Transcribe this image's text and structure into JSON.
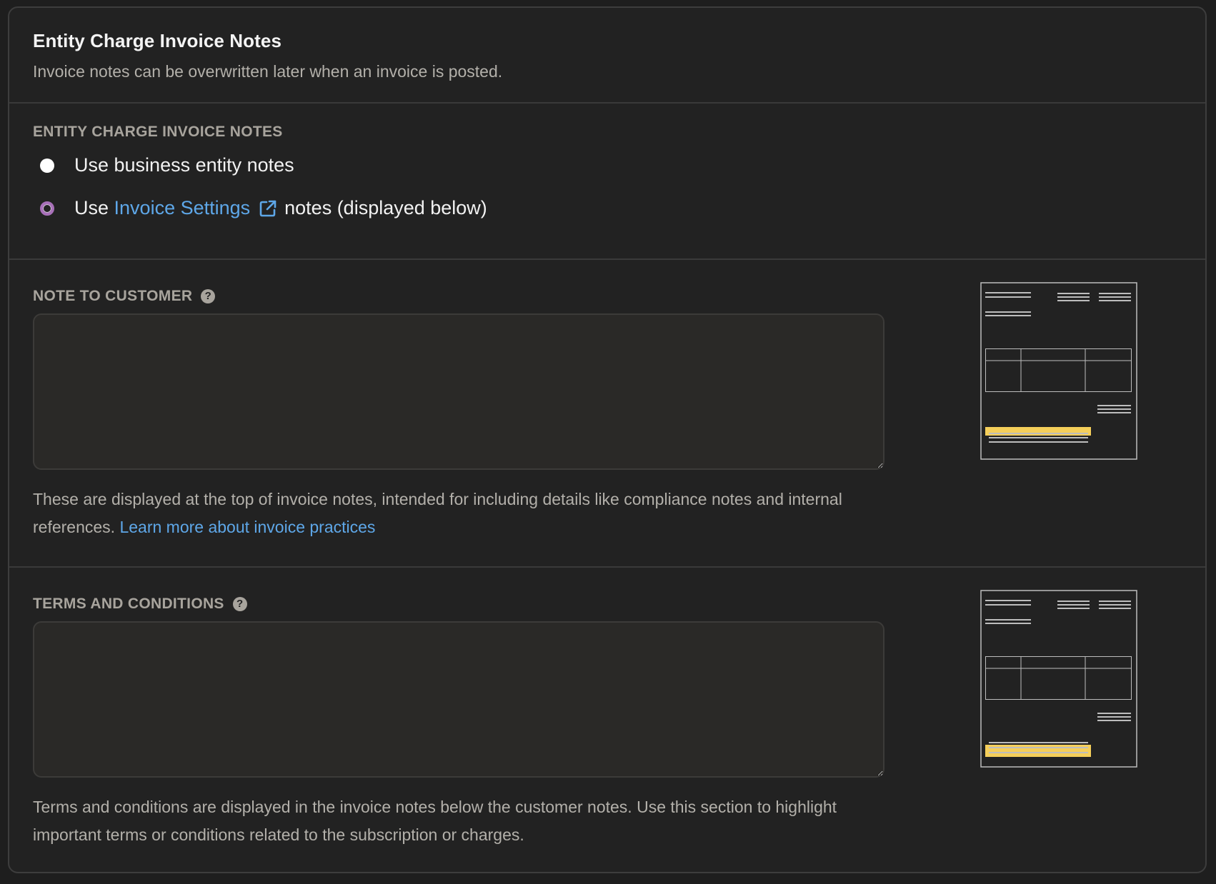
{
  "header": {
    "title": "Entity Charge Invoice Notes",
    "subtitle": "Invoice notes can be overwritten later when an invoice is posted."
  },
  "notes_source": {
    "label": "ENTITY CHARGE INVOICE NOTES",
    "option_business": "Use business entity notes",
    "option_invoice_prefix": "Use",
    "option_invoice_link": "Invoice Settings",
    "option_invoice_suffix": "notes (displayed below)",
    "selected": "invoice_settings"
  },
  "note_to_customer": {
    "label": "NOTE TO CUSTOMER",
    "value": "",
    "help_text": "These are displayed at the top of invoice notes, intended for including details like compliance notes and internal references.",
    "help_link": "Learn more about invoice practices"
  },
  "terms_and_conditions": {
    "label": "TERMS AND CONDITIONS",
    "value": "",
    "help_text": "Terms and conditions are displayed in the invoice notes below the customer notes. Use this section to highlight important terms or conditions related to the subscription or charges."
  },
  "colors": {
    "accent_radio": "#a870b9",
    "link": "#5ea7e8",
    "highlight": "#f5cf5a"
  },
  "icons": {
    "help": "question-circle-icon",
    "external_link": "external-link-icon"
  }
}
